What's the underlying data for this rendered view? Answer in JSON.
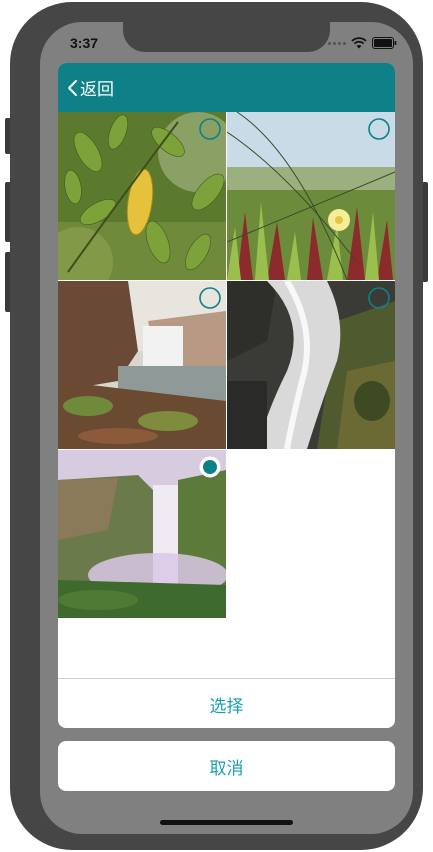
{
  "status_bar": {
    "time": "3:37"
  },
  "navbar": {
    "back_label": "返回",
    "accent": "#0e8088"
  },
  "photos": [
    {
      "name": "leaves",
      "selected": false
    },
    {
      "name": "ice-plant-flower",
      "selected": false
    },
    {
      "name": "waterfall-cliffs",
      "selected": false
    },
    {
      "name": "waterfall-long-exposure",
      "selected": false
    },
    {
      "name": "misty-waterfall",
      "selected": true
    }
  ],
  "actions": {
    "select_label": "选择",
    "cancel_label": "取消",
    "text_color": "#1a9fb3"
  }
}
